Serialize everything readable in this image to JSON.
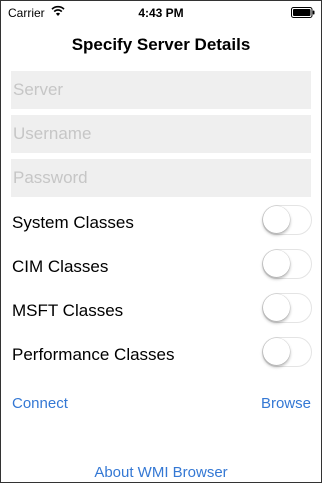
{
  "status_bar": {
    "carrier": "Carrier",
    "time": "4:43 PM",
    "wifi_icon": "wifi-icon",
    "battery_icon": "battery-full-icon"
  },
  "nav": {
    "title": "Specify Server Details"
  },
  "form": {
    "server": {
      "value": "",
      "placeholder": "Server"
    },
    "username": {
      "value": "",
      "placeholder": "Username"
    },
    "password": {
      "value": "",
      "placeholder": "Password"
    }
  },
  "options": [
    {
      "label": "System Classes",
      "on": false
    },
    {
      "label": "CIM Classes",
      "on": false
    },
    {
      "label": "MSFT Classes",
      "on": false
    },
    {
      "label": "Performance Classes",
      "on": false
    }
  ],
  "actions": {
    "connect_label": "Connect",
    "browse_label": "Browse",
    "about_label": "About WMI Browser"
  },
  "colors": {
    "accent": "#3478d4",
    "field_background": "#efefef",
    "placeholder": "#c6c6c6"
  }
}
